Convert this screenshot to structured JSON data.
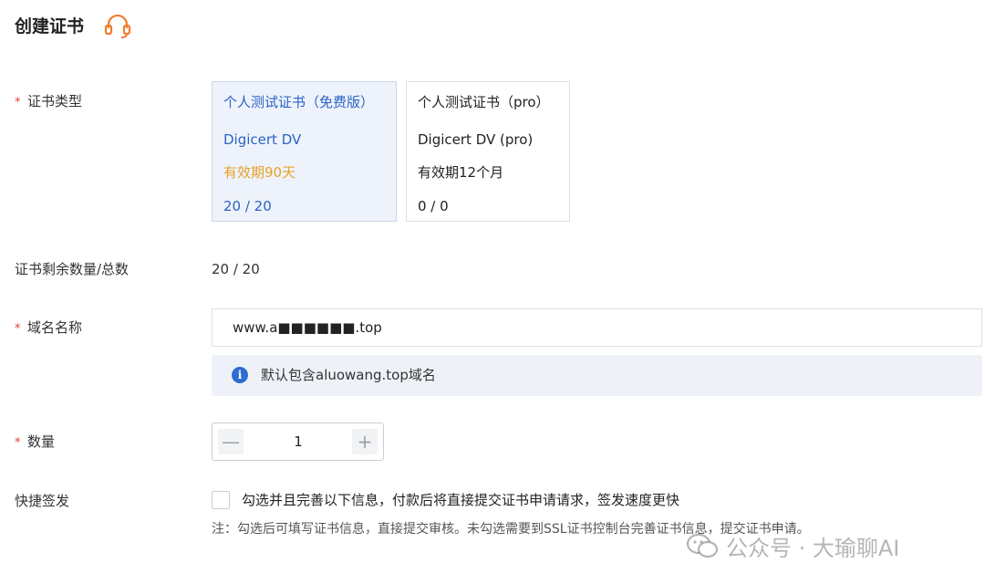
{
  "page": {
    "title": "创建证书"
  },
  "form": {
    "cert_type": {
      "label": "证书类型",
      "options": [
        {
          "name": "个人测试证书（免费版）",
          "product": "Digicert DV",
          "validity": "有效期90天",
          "quota": "20 / 20",
          "selected": true
        },
        {
          "name": "个人测试证书（pro）",
          "product": "Digicert DV (pro)",
          "validity": "有效期12个月",
          "quota": "0 / 0",
          "selected": false
        }
      ]
    },
    "remaining": {
      "label": "证书剩余数量/总数",
      "value": "20 / 20"
    },
    "domain": {
      "label": "域名名称",
      "value": "www.a■■■■■■.top",
      "info_text": "默认包含aluowang.top域名"
    },
    "quantity": {
      "label": "数量",
      "value": "1",
      "minus_symbol": "—",
      "plus_symbol": "+"
    },
    "quick_issue": {
      "label": "快捷签发",
      "checkbox_text": "勾选并且完善以下信息，付款后将直接提交证书申请请求，签发速度更快",
      "checked": false,
      "note": "注：勾选后可填写证书信息，直接提交审核。未勾选需要到SSL证书控制台完善证书信息，提交证书申请。"
    },
    "required_marker": "*"
  },
  "watermark": {
    "text": "公众号 · 大瑜聊AI"
  },
  "colors": {
    "accent_blue": "#2b63c4",
    "validity_orange": "#e7a12a",
    "required_red": "#e0413d",
    "support_icon_orange": "#f07c2d"
  }
}
